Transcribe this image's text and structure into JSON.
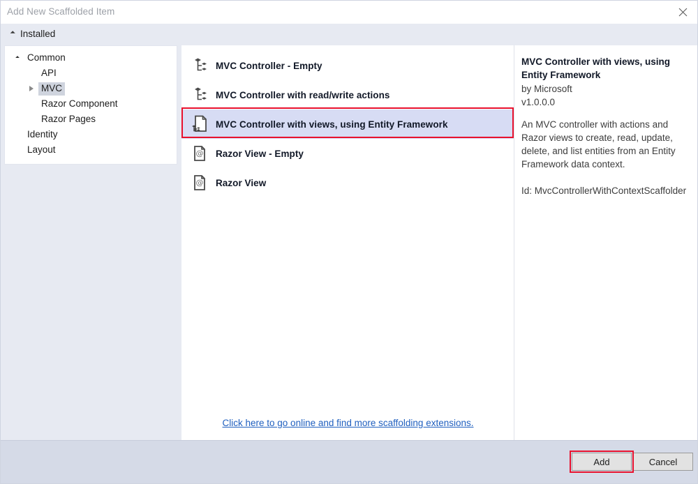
{
  "window": {
    "title": "Add New Scaffolded Item",
    "close_icon": "close-icon"
  },
  "installed": {
    "label": "Installed",
    "expander_icon": "triangle-down-icon"
  },
  "sidebar": {
    "items": [
      {
        "label": "Common",
        "level": 0,
        "expander": "triangle-down-icon",
        "selected": false
      },
      {
        "label": "API",
        "level": 1,
        "expander": "none",
        "selected": false
      },
      {
        "label": "MVC",
        "level": 1,
        "expander": "triangle-right-icon",
        "selected": true
      },
      {
        "label": "Razor Component",
        "level": 1,
        "expander": "none",
        "selected": false
      },
      {
        "label": "Razor Pages",
        "level": 1,
        "expander": "none",
        "selected": false
      },
      {
        "label": "Identity",
        "level": 0,
        "expander": "none",
        "selected": false
      },
      {
        "label": "Layout",
        "level": 0,
        "expander": "none",
        "selected": false
      }
    ]
  },
  "list": {
    "items": [
      {
        "label": "MVC Controller - Empty",
        "icon": "controller-nodes-icon",
        "selected": false
      },
      {
        "label": "MVC Controller with read/write actions",
        "icon": "controller-nodes-icon",
        "selected": false
      },
      {
        "label": "MVC Controller with views, using Entity Framework",
        "icon": "page-with-controller-nodes-icon",
        "selected": true
      },
      {
        "label": "Razor View - Empty",
        "icon": "page-at-symbol-icon",
        "selected": false
      },
      {
        "label": "Razor View",
        "icon": "page-at-symbol-icon",
        "selected": false
      }
    ],
    "link_text": "Click here to go online and find more scaffolding extensions."
  },
  "details": {
    "title": "MVC Controller with views, using Entity Framework",
    "author": "by Microsoft",
    "version": "v1.0.0.0",
    "description": "An MVC controller with actions and Razor views to create, read, update, delete, and list entities from an Entity Framework data context.",
    "id": "Id: MvcControllerWithContextScaffolder"
  },
  "footer": {
    "add_label": "Add",
    "cancel_label": "Cancel"
  },
  "colors": {
    "selection_highlight": "#d7dcf4",
    "annotation_red": "#e8112d",
    "band_background": "#e7eaf2",
    "footer_background": "#d5dae7",
    "link_blue": "#1f5fbf"
  }
}
